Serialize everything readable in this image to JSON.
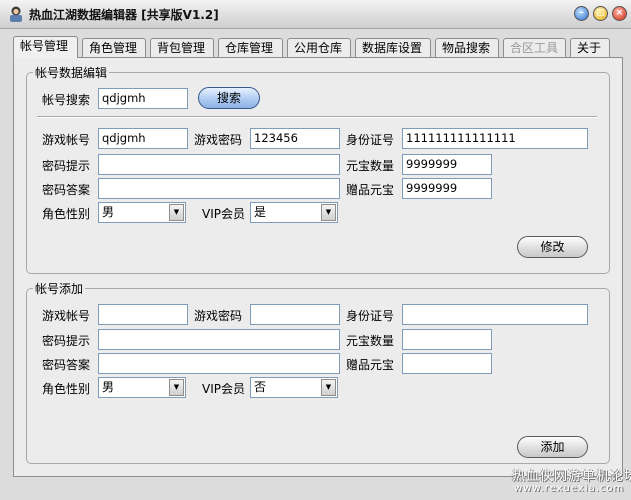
{
  "window": {
    "title": "热血江湖数据编辑器 [共享版V1.2]",
    "controls": {
      "min": "minimize-icon",
      "max": "maximize-icon",
      "close": "close-icon"
    }
  },
  "tabs": [
    {
      "label": "帐号管理",
      "active": true
    },
    {
      "label": "角色管理"
    },
    {
      "label": "背包管理"
    },
    {
      "label": "仓库管理"
    },
    {
      "label": "公用仓库"
    },
    {
      "label": "数据库设置"
    },
    {
      "label": "物品搜索"
    },
    {
      "label": "合区工具",
      "disabled": true
    },
    {
      "label": "关于"
    }
  ],
  "edit": {
    "group_title": "帐号数据编辑",
    "search_label": "帐号搜索",
    "search_value": "qdjgmh",
    "search_button": "搜索",
    "account_label": "游戏帐号",
    "account_value": "qdjgmh",
    "password_label": "游戏密码",
    "password_value": "123456",
    "id_label": "身份证号",
    "id_value": "111111111111111",
    "hint_label": "密码提示",
    "hint_value": "",
    "yuanbao_label": "元宝数量",
    "yuanbao_value": "9999999",
    "answer_label": "密码答案",
    "answer_value": "",
    "gift_label": "赠品元宝",
    "gift_value": "9999999",
    "gender_label": "角色性别",
    "gender_value": "男",
    "vip_label": "VIP会员",
    "vip_value": "是",
    "modify_button": "修改"
  },
  "add": {
    "group_title": "帐号添加",
    "account_label": "游戏帐号",
    "account_value": "",
    "password_label": "游戏密码",
    "password_value": "",
    "id_label": "身份证号",
    "id_value": "",
    "hint_label": "密码提示",
    "hint_value": "",
    "yuanbao_label": "元宝数量",
    "yuanbao_value": "",
    "answer_label": "密码答案",
    "answer_value": "",
    "gift_label": "赠品元宝",
    "gift_value": "",
    "gender_label": "角色性别",
    "gender_value": "男",
    "vip_label": "VIP会员",
    "vip_value": "否",
    "add_button": "添加"
  },
  "watermark": {
    "text": "热血侠网游单机论坛",
    "url": "www.rexuexia.com"
  }
}
